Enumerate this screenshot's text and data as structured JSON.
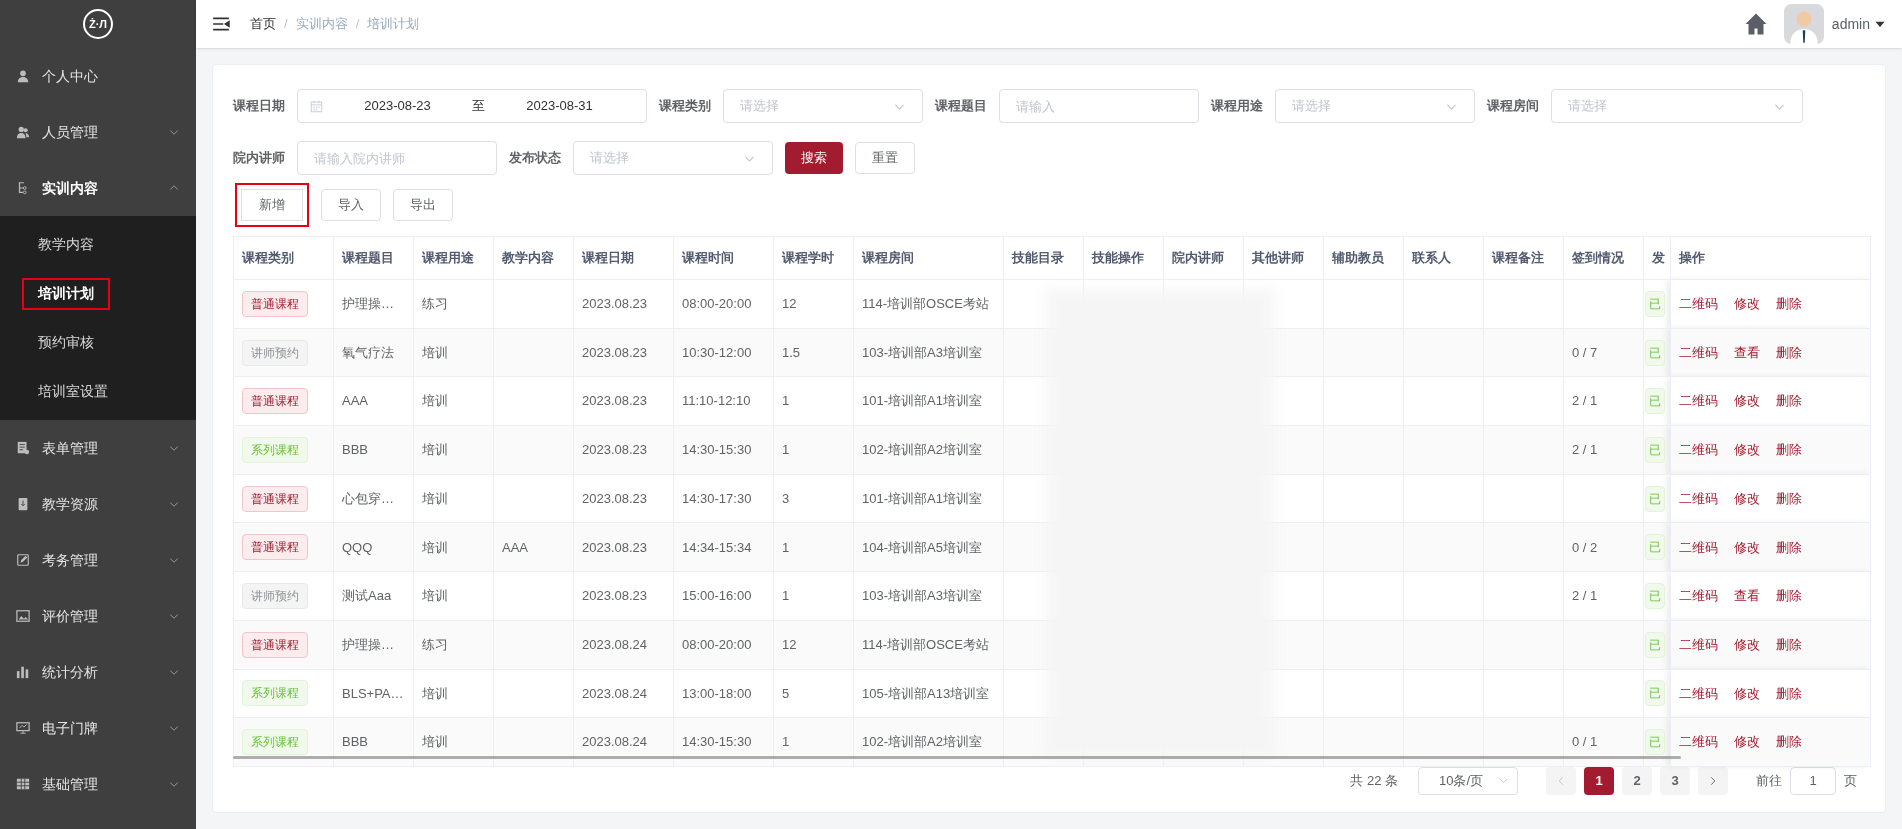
{
  "logo": {
    "text": "Ż·Л"
  },
  "sidebar": {
    "items": [
      {
        "label": "个人中心",
        "expanded": false,
        "has_children": false
      },
      {
        "label": "人员管理",
        "expanded": false,
        "has_children": true
      },
      {
        "label": "实训内容",
        "expanded": true,
        "has_children": true,
        "children": [
          {
            "label": "教学内容",
            "selected": false,
            "highlighted": false
          },
          {
            "label": "培训计划",
            "selected": true,
            "highlighted": true
          },
          {
            "label": "预约审核",
            "selected": false,
            "highlighted": false
          },
          {
            "label": "培训室设置",
            "selected": false,
            "highlighted": false
          }
        ]
      },
      {
        "label": "表单管理",
        "expanded": false,
        "has_children": true
      },
      {
        "label": "教学资源",
        "expanded": false,
        "has_children": true
      },
      {
        "label": "考务管理",
        "expanded": false,
        "has_children": true
      },
      {
        "label": "评价管理",
        "expanded": false,
        "has_children": true
      },
      {
        "label": "统计分析",
        "expanded": false,
        "has_children": true
      },
      {
        "label": "电子门牌",
        "expanded": false,
        "has_children": true
      },
      {
        "label": "基础管理",
        "expanded": false,
        "has_children": true
      }
    ]
  },
  "breadcrumb": [
    {
      "label": "首页"
    },
    {
      "separator": "/",
      "label": "实训内容"
    },
    {
      "separator": "/",
      "label": "培训计划"
    }
  ],
  "user": {
    "name": "admin"
  },
  "filters": [
    {
      "kind": "daterange",
      "label": "课程日期",
      "start": "2023-08-23",
      "separator": "至",
      "end": "2023-08-31"
    },
    {
      "kind": "select",
      "label": "课程类别",
      "placeholder": "请选择"
    },
    {
      "kind": "input",
      "label": "课程题目",
      "placeholder": "请输入"
    },
    {
      "kind": "select",
      "label": "课程用途",
      "placeholder": "请选择"
    },
    {
      "kind": "select",
      "label": "课程房间",
      "placeholder": "请选择"
    },
    {
      "kind": "input",
      "label": "院内讲师",
      "placeholder": "请输入院内讲师"
    },
    {
      "kind": "select",
      "label": "发布状态",
      "placeholder": "请选择"
    }
  ],
  "filter_buttons": [
    {
      "label": "搜索",
      "primary": true
    },
    {
      "label": "重置",
      "primary": false
    }
  ],
  "toolbar": [
    {
      "label": "新增",
      "highlighted": true
    },
    {
      "label": "导入",
      "highlighted": false
    },
    {
      "label": "导出",
      "highlighted": false
    }
  ],
  "table": {
    "columns": [
      "课程类别",
      "课程题目",
      "课程用途",
      "教学内容",
      "课程日期",
      "课程时间",
      "课程学时",
      "课程房间",
      "技能目录",
      "技能操作",
      "院内讲师",
      "其他讲师",
      "辅助教员",
      "联系人",
      "课程备注",
      "签到情况",
      "发",
      "操作"
    ],
    "rows": [
      {
        "kind": "normal",
        "category": "普通课程",
        "title": "护理操…",
        "use": "练习",
        "content": "",
        "date": "2023.08.23",
        "time": "08:00-20:00",
        "hours": "12",
        "room": "114-培训部OSCE考站",
        "signin": "",
        "status": "已",
        "actions": [
          "二维码",
          "修改",
          "删除"
        ]
      },
      {
        "kind": "teacher",
        "category": "讲师预约",
        "title": "氧气疗法",
        "use": "培训",
        "content": "",
        "date": "2023.08.23",
        "time": "10:30-12:00",
        "hours": "1.5",
        "room": "103-培训部A3培训室",
        "signin": "0 / 7",
        "status": "已",
        "actions": [
          "二维码",
          "查看",
          "删除"
        ]
      },
      {
        "kind": "normal",
        "category": "普通课程",
        "title": "AAA",
        "use": "培训",
        "content": "",
        "date": "2023.08.23",
        "time": "11:10-12:10",
        "hours": "1",
        "room": "101-培训部A1培训室",
        "signin": "2 / 1",
        "status": "已",
        "actions": [
          "二维码",
          "修改",
          "删除"
        ]
      },
      {
        "kind": "series",
        "category": "系列课程",
        "title": "BBB",
        "use": "培训",
        "content": "",
        "date": "2023.08.23",
        "time": "14:30-15:30",
        "hours": "1",
        "room": "102-培训部A2培训室",
        "signin": "2 / 1",
        "status": "已",
        "actions": [
          "二维码",
          "修改",
          "删除"
        ]
      },
      {
        "kind": "normal",
        "category": "普通课程",
        "title": "心包穿…",
        "use": "培训",
        "content": "",
        "date": "2023.08.23",
        "time": "14:30-17:30",
        "hours": "3",
        "room": "101-培训部A1培训室",
        "signin": "",
        "status": "已",
        "actions": [
          "二维码",
          "修改",
          "删除"
        ]
      },
      {
        "kind": "normal",
        "category": "普通课程",
        "title": "QQQ",
        "use": "培训",
        "content": "AAA",
        "date": "2023.08.23",
        "time": "14:34-15:34",
        "hours": "1",
        "room": "104-培训部A5培训室",
        "signin": "0 / 2",
        "status": "已",
        "actions": [
          "二维码",
          "修改",
          "删除"
        ]
      },
      {
        "kind": "teacher",
        "category": "讲师预约",
        "title": "测试Aaa",
        "use": "培训",
        "content": "",
        "date": "2023.08.23",
        "time": "15:00-16:00",
        "hours": "1",
        "room": "103-培训部A3培训室",
        "signin": "2 / 1",
        "status": "已",
        "actions": [
          "二维码",
          "查看",
          "删除"
        ]
      },
      {
        "kind": "normal",
        "category": "普通课程",
        "title": "护理操…",
        "use": "练习",
        "content": "",
        "date": "2023.08.24",
        "time": "08:00-20:00",
        "hours": "12",
        "room": "114-培训部OSCE考站",
        "signin": "",
        "status": "已",
        "actions": [
          "二维码",
          "修改",
          "删除"
        ]
      },
      {
        "kind": "series",
        "category": "系列课程",
        "title": "BLS+PA…",
        "use": "培训",
        "content": "",
        "date": "2023.08.24",
        "time": "13:00-18:00",
        "hours": "5",
        "room": "105-培训部A13培训室",
        "signin": "",
        "status": "已",
        "actions": [
          "二维码",
          "修改",
          "删除"
        ]
      },
      {
        "kind": "series",
        "category": "系列课程",
        "title": "BBB",
        "use": "培训",
        "content": "",
        "date": "2023.08.24",
        "time": "14:30-15:30",
        "hours": "1",
        "room": "102-培训部A2培训室",
        "signin": "0 / 1",
        "status": "已",
        "actions": [
          "二维码",
          "修改",
          "删除"
        ]
      }
    ]
  },
  "pagination": {
    "total": "共 22 条",
    "page_size": "10条/页",
    "pages": [
      {
        "label": "1",
        "selected": true
      },
      {
        "label": "2",
        "selected": false
      },
      {
        "label": "3",
        "selected": false
      }
    ],
    "goto_label": "前往",
    "goto_value": "1",
    "goto_suffix": "页"
  }
}
